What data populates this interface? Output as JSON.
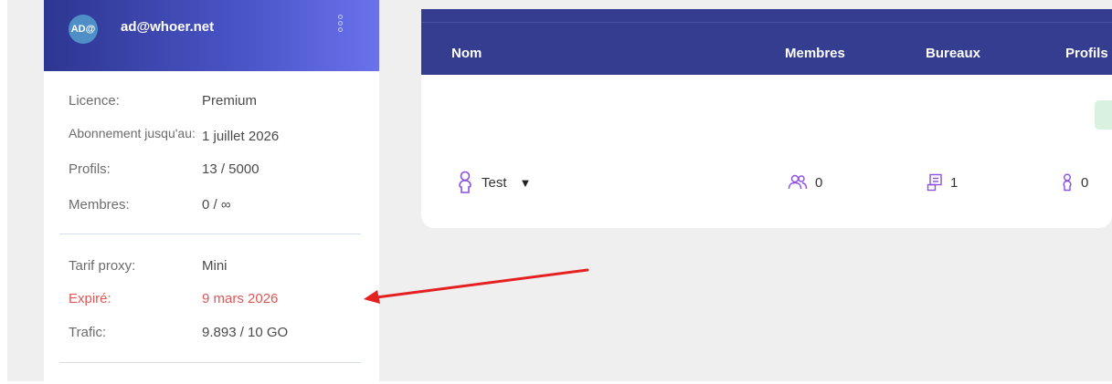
{
  "account": {
    "avatar_text": "AD@",
    "email": "ad@whoer.net"
  },
  "license": [
    {
      "label": "Licence:",
      "value": "Premium"
    },
    {
      "label": "Abonnement jusqu'au:",
      "value": "1 juillet 2026"
    },
    {
      "label": "Profils:",
      "value": "13 / 5000"
    },
    {
      "label": "Membres:",
      "value": "0 / ∞"
    }
  ],
  "proxy": [
    {
      "label": "Tarif proxy:",
      "value": "Mini"
    },
    {
      "label": "Expiré:",
      "value": "9 mars 2026",
      "status": "expired"
    },
    {
      "label": "Trafic:",
      "value": "9.893 / 10 GO"
    }
  ],
  "table": {
    "columns": [
      "Nom",
      "Membres",
      "Bureaux",
      "Profils"
    ],
    "rows": [
      {
        "name": "Test",
        "members": "0",
        "offices": "1",
        "profiles": "0"
      }
    ]
  },
  "colors": {
    "header_dark": "#343d8f",
    "expired": "#e05555",
    "icon_purple": "#8a4fe0",
    "arrow": "#e52020"
  }
}
